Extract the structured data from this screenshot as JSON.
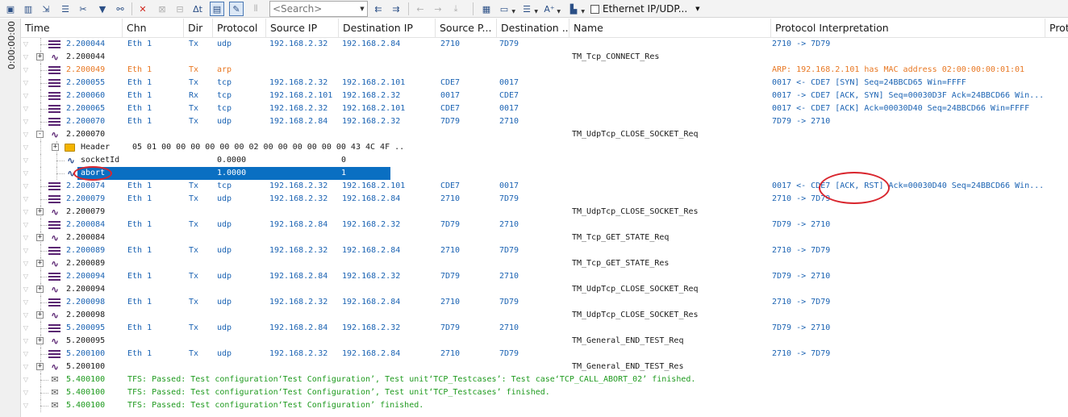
{
  "toolbar": {
    "search_placeholder": "<Search>",
    "network_filter": "Ethernet IP/UDP...",
    "icons": [
      "window-icon",
      "chart-icon",
      "export-icon",
      "bars-icon",
      "tools-icon",
      "filter-icon",
      "binoculars-icon",
      "delete-icon",
      "disabled-icon",
      "disabled-icon",
      "delta-time-icon",
      "columns-icon",
      "comment-icon",
      "disabled-icon",
      "search-dropdown",
      "arrow-left-double-icon",
      "arrow-right-double-icon",
      "arrow-left-icon",
      "arrow-right-icon",
      "jump-icon",
      "window-split-icon",
      "folder-icon",
      "line-style-icon",
      "font-size-icon",
      "layout-icon"
    ]
  },
  "left_time_label": "0:00:00:00",
  "columns": [
    "Time",
    "Chn",
    "Dir",
    "Protocol",
    "Source IP",
    "Destination IP",
    "Source P...",
    "Destination ...",
    "Name",
    "Protocol Interpretation",
    "Proto"
  ],
  "rows": [
    {
      "icon": "frame",
      "time": "2.200044",
      "chn": "Eth 1",
      "dir": "Tx",
      "protocol": "udp",
      "src_ip": "192.168.2.32",
      "dst_ip": "192.168.2.84",
      "src_port": "2710",
      "dst_port": "7D79",
      "name": "",
      "interp": "2710 -> 7D79",
      "style": "blue"
    },
    {
      "icon": "signal",
      "expand": "+",
      "time": "2.200044",
      "chn": "",
      "dir": "",
      "protocol": "",
      "src_ip": "",
      "dst_ip": "",
      "src_port": "",
      "dst_port": "",
      "name": "TM_Tcp_CONNECT_Res",
      "interp": "",
      "style": "dark"
    },
    {
      "icon": "frame",
      "time": "2.200049",
      "chn": "Eth 1",
      "dir": "Tx",
      "protocol": "arp",
      "src_ip": "",
      "dst_ip": "",
      "src_port": "",
      "dst_port": "",
      "name": "",
      "interp": "ARP: 192.168.2.101 has MAC address 02:00:00:00:01:01",
      "style": "orange"
    },
    {
      "icon": "frame",
      "time": "2.200055",
      "chn": "Eth 1",
      "dir": "Tx",
      "protocol": "tcp",
      "src_ip": "192.168.2.32",
      "dst_ip": "192.168.2.101",
      "src_port": "CDE7",
      "dst_port": "0017",
      "name": "",
      "interp": "0017 <- CDE7 [SYN] Seq=24BBCD65 Win=FFFF",
      "style": "blue"
    },
    {
      "icon": "frame",
      "time": "2.200060",
      "chn": "Eth 1",
      "dir": "Rx",
      "protocol": "tcp",
      "src_ip": "192.168.2.101",
      "dst_ip": "192.168.2.32",
      "src_port": "0017",
      "dst_port": "CDE7",
      "name": "",
      "interp": "0017 -> CDE7 [ACK, SYN] Seq=00030D3F Ack=24BBCD66 Win...",
      "style": "blue"
    },
    {
      "icon": "frame",
      "time": "2.200065",
      "chn": "Eth 1",
      "dir": "Tx",
      "protocol": "tcp",
      "src_ip": "192.168.2.32",
      "dst_ip": "192.168.2.101",
      "src_port": "CDE7",
      "dst_port": "0017",
      "name": "",
      "interp": "0017 <- CDE7 [ACK] Ack=00030D40 Seq=24BBCD66 Win=FFFF",
      "style": "blue"
    },
    {
      "icon": "frame",
      "time": "2.200070",
      "chn": "Eth 1",
      "dir": "Tx",
      "protocol": "udp",
      "src_ip": "192.168.2.84",
      "dst_ip": "192.168.2.32",
      "src_port": "7D79",
      "dst_port": "2710",
      "name": "",
      "interp": "7D79 -> 2710",
      "style": "blue"
    },
    {
      "icon": "signal",
      "expand": "-",
      "time": "2.200070",
      "chn": "",
      "dir": "",
      "protocol": "",
      "src_ip": "",
      "dst_ip": "",
      "src_port": "",
      "dst_port": "",
      "name": "TM_UdpTcp_CLOSE_SOCKET_Req",
      "interp": "",
      "style": "dark"
    },
    {
      "icon": "folder",
      "expand": "+",
      "level": 1,
      "label": "Header",
      "value": "05 01 00 00 00 00 00 00 02 00 00 00 00 00 00 43 4C 4F  ..",
      "style": "dark"
    },
    {
      "icon": "signal-blue",
      "level": 1,
      "label": "socketId",
      "value1": "0.0000",
      "value2": "0",
      "style": "dark"
    },
    {
      "icon": "signal-blue",
      "level": 1,
      "label": "abort",
      "value1": "1.0000",
      "value2": "1",
      "style": "dark",
      "selected": true
    },
    {
      "icon": "frame",
      "time": "2.200074",
      "chn": "Eth 1",
      "dir": "Tx",
      "protocol": "tcp",
      "src_ip": "192.168.2.32",
      "dst_ip": "192.168.2.101",
      "src_port": "CDE7",
      "dst_port": "0017",
      "name": "",
      "interp": "0017 <- CDE7 [ACK, RST] Ack=00030D40 Seq=24BBCD66 Win...",
      "style": "blue"
    },
    {
      "icon": "frame",
      "time": "2.200079",
      "chn": "Eth 1",
      "dir": "Tx",
      "protocol": "udp",
      "src_ip": "192.168.2.32",
      "dst_ip": "192.168.2.84",
      "src_port": "2710",
      "dst_port": "7D79",
      "name": "",
      "interp": "2710 -> 7D79",
      "style": "blue"
    },
    {
      "icon": "signal",
      "expand": "+",
      "time": "2.200079",
      "chn": "",
      "dir": "",
      "protocol": "",
      "src_ip": "",
      "dst_ip": "",
      "src_port": "",
      "dst_port": "",
      "name": "TM_UdpTcp_CLOSE_SOCKET_Res",
      "interp": "",
      "style": "dark"
    },
    {
      "icon": "frame",
      "time": "2.200084",
      "chn": "Eth 1",
      "dir": "Tx",
      "protocol": "udp",
      "src_ip": "192.168.2.84",
      "dst_ip": "192.168.2.32",
      "src_port": "7D79",
      "dst_port": "2710",
      "name": "",
      "interp": "7D79 -> 2710",
      "style": "blue"
    },
    {
      "icon": "signal",
      "expand": "+",
      "time": "2.200084",
      "chn": "",
      "dir": "",
      "protocol": "",
      "src_ip": "",
      "dst_ip": "",
      "src_port": "",
      "dst_port": "",
      "name": "TM_Tcp_GET_STATE_Req",
      "interp": "",
      "style": "dark"
    },
    {
      "icon": "frame",
      "time": "2.200089",
      "chn": "Eth 1",
      "dir": "Tx",
      "protocol": "udp",
      "src_ip": "192.168.2.32",
      "dst_ip": "192.168.2.84",
      "src_port": "2710",
      "dst_port": "7D79",
      "name": "",
      "interp": "2710 -> 7D79",
      "style": "blue"
    },
    {
      "icon": "signal",
      "expand": "+",
      "time": "2.200089",
      "chn": "",
      "dir": "",
      "protocol": "",
      "src_ip": "",
      "dst_ip": "",
      "src_port": "",
      "dst_port": "",
      "name": "TM_Tcp_GET_STATE_Res",
      "interp": "",
      "style": "dark"
    },
    {
      "icon": "frame",
      "time": "2.200094",
      "chn": "Eth 1",
      "dir": "Tx",
      "protocol": "udp",
      "src_ip": "192.168.2.84",
      "dst_ip": "192.168.2.32",
      "src_port": "7D79",
      "dst_port": "2710",
      "name": "",
      "interp": "7D79 -> 2710",
      "style": "blue"
    },
    {
      "icon": "signal",
      "expand": "+",
      "time": "2.200094",
      "chn": "",
      "dir": "",
      "protocol": "",
      "src_ip": "",
      "dst_ip": "",
      "src_port": "",
      "dst_port": "",
      "name": "TM_UdpTcp_CLOSE_SOCKET_Req",
      "interp": "",
      "style": "dark"
    },
    {
      "icon": "frame",
      "time": "2.200098",
      "chn": "Eth 1",
      "dir": "Tx",
      "protocol": "udp",
      "src_ip": "192.168.2.32",
      "dst_ip": "192.168.2.84",
      "src_port": "2710",
      "dst_port": "7D79",
      "name": "",
      "interp": "2710 -> 7D79",
      "style": "blue"
    },
    {
      "icon": "signal",
      "expand": "+",
      "time": "2.200098",
      "chn": "",
      "dir": "",
      "protocol": "",
      "src_ip": "",
      "dst_ip": "",
      "src_port": "",
      "dst_port": "",
      "name": "TM_UdpTcp_CLOSE_SOCKET_Res",
      "interp": "",
      "style": "dark"
    },
    {
      "icon": "frame",
      "time": "5.200095",
      "chn": "Eth 1",
      "dir": "Tx",
      "protocol": "udp",
      "src_ip": "192.168.2.84",
      "dst_ip": "192.168.2.32",
      "src_port": "7D79",
      "dst_port": "2710",
      "name": "",
      "interp": "7D79 -> 2710",
      "style": "blue"
    },
    {
      "icon": "signal",
      "expand": "+",
      "time": "5.200095",
      "chn": "",
      "dir": "",
      "protocol": "",
      "src_ip": "",
      "dst_ip": "",
      "src_port": "",
      "dst_port": "",
      "name": "TM_General_END_TEST_Req",
      "interp": "",
      "style": "dark"
    },
    {
      "icon": "frame",
      "time": "5.200100",
      "chn": "Eth 1",
      "dir": "Tx",
      "protocol": "udp",
      "src_ip": "192.168.2.32",
      "dst_ip": "192.168.2.84",
      "src_port": "2710",
      "dst_port": "7D79",
      "name": "",
      "interp": "2710 -> 7D79",
      "style": "blue"
    },
    {
      "icon": "signal",
      "expand": "+",
      "time": "5.200100",
      "chn": "",
      "dir": "",
      "protocol": "",
      "src_ip": "",
      "dst_ip": "",
      "src_port": "",
      "dst_port": "",
      "name": "TM_General_END_TEST_Res",
      "interp": "",
      "style": "dark"
    },
    {
      "icon": "envelope",
      "time": "5.400100",
      "message": "TFS: Passed: Test configuration‘Test Configuration’, Test unit‘TCP_Testcases’: Test case‘TCP_CALL_ABORT_02’ finished.",
      "style": "green"
    },
    {
      "icon": "envelope",
      "time": "5.400100",
      "message": "TFS: Passed: Test configuration‘Test Configuration’, Test unit‘TCP_Testcases’ finished.",
      "style": "green"
    },
    {
      "icon": "envelope",
      "time": "5.400100",
      "message": "TFS: Passed: Test configuration‘Test Configuration’ finished.",
      "style": "green"
    }
  ]
}
